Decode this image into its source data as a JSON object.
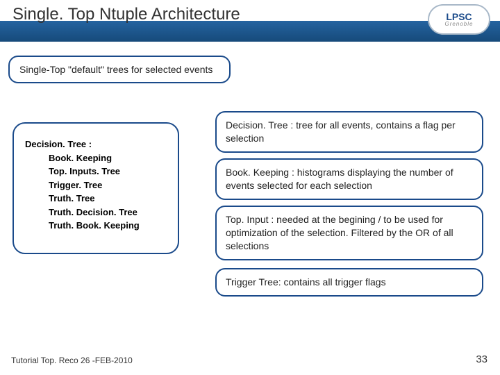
{
  "header": {
    "title": "Single. Top Ntuple Architecture",
    "logo_main": "LPSC",
    "logo_sub": "Grenoble"
  },
  "subtitle": "Single-Top \"default\" trees for selected events",
  "tree": {
    "root": "Decision. Tree :",
    "items": [
      "Book. Keeping",
      "Top. Inputs. Tree",
      "Trigger. Tree",
      "Truth. Tree",
      "Truth. Decision. Tree",
      "Truth. Book. Keeping"
    ]
  },
  "descriptions": {
    "d1": "Decision. Tree : tree for all events, contains a flag per selection",
    "d2": "Book. Keeping : histograms displaying the number of events selected for each selection",
    "d3": "Top. Input : needed at the begining / to be used for optimization of the selection. Filtered by the OR of all selections",
    "d4": "Trigger Tree: contains all trigger flags"
  },
  "footer": {
    "left": "Tutorial Top. Reco 26 -FEB-2010",
    "page": "33"
  }
}
